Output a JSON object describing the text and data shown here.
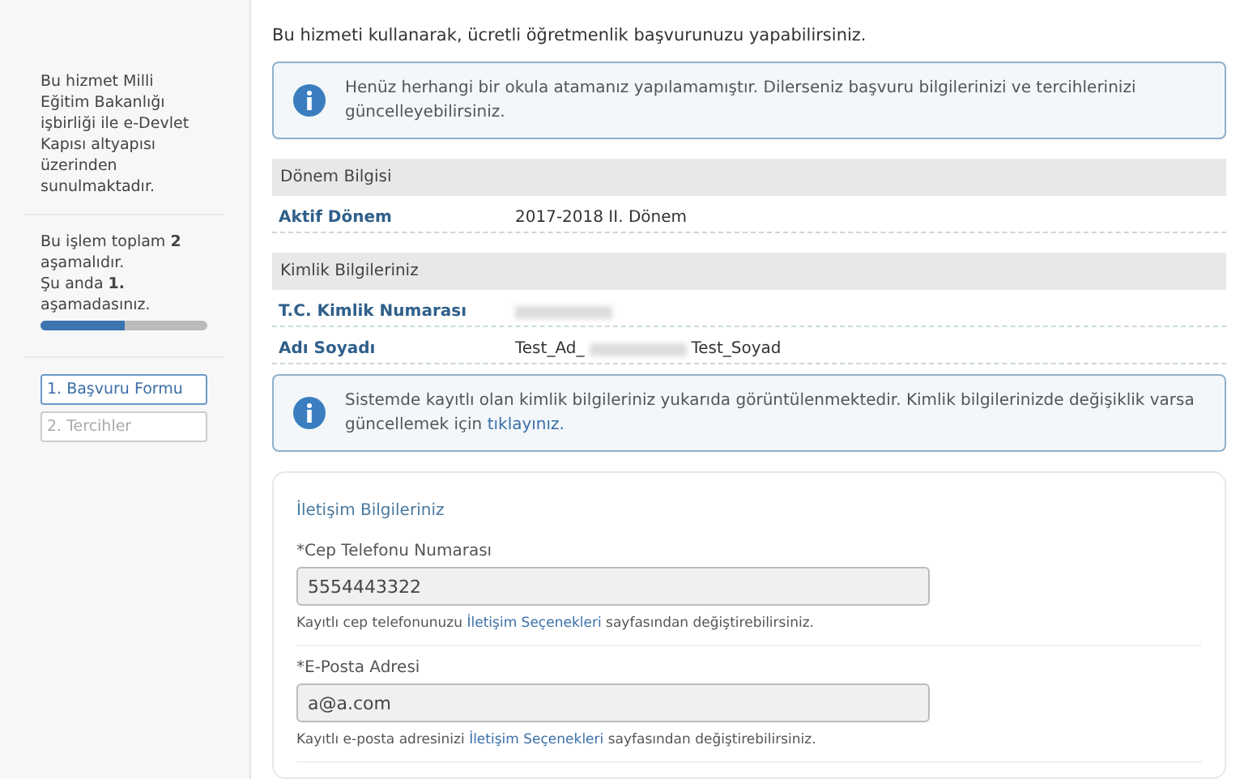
{
  "sidebar": {
    "intro": "Bu hizmet Milli Eğitim Bakanlığı işbirliği ile e-Devlet Kapısı altyapısı üzerinden sunulmaktadır.",
    "progress_text": "Bu işlem toplam **2** aşamalıdır.",
    "progress_current": "Şu anda **1.** aşamadasınız.",
    "progress": {
      "level": 0.5
    },
    "steps": [
      {
        "label": "1. Başvuru Formu",
        "selected": true
      },
      {
        "label": "2. Tercihler",
        "selected": false
      }
    ]
  },
  "intro": "Bu hizmeti kullanarak, ücretli öğretmenlik başvurunuzu yapabilirsiniz.",
  "notice": {
    "text": "Henüz herhangi bir okula atamanız yapılamamıştır. Dilerseniz başvuru bilgilerinizi ve tercihlerinizi güncelleyebilirsiniz."
  },
  "term": {
    "heading": "Dönem Bilgisi",
    "rows": [
      {
        "label": "Aktif Dönem",
        "parts": [
          {
            "kind": "text",
            "text": "2017-2018 II. Dönem"
          }
        ]
      }
    ]
  },
  "identity": {
    "heading": "Kimlik Bilgileriniz",
    "rows": [
      {
        "label": "T.C. Kimlik Numarası",
        "parts": [
          {
            "kind": "redacted"
          }
        ]
      },
      {
        "label": "Adı Soyadı",
        "parts": [
          {
            "kind": "text",
            "text": "Test_Ad_"
          },
          {
            "kind": "redacted"
          },
          {
            "kind": "text",
            "text": "Test_Soyad"
          }
        ]
      }
    ],
    "notice": {
      "text": "Sistemde kayıtlı olan kimlik bilgileriniz yukarıda görüntülenmektedir. Kimlik bilgilerinizde değişiklik varsa güncellemek için",
      "link": "tıklayınız."
    }
  },
  "contact": {
    "heading": "İletişim Bilgileriniz",
    "fields": [
      {
        "label": "*Cep Telefonu Numarası",
        "value": "5554443322",
        "help_before": "Kayıtlı cep telefonunuzu",
        "help_link": "İletişim Seçenekleri",
        "help_after": "sayfasından değiştirebilirsiniz."
      },
      {
        "label": "*E-Posta Adresi",
        "value": "a@a.com",
        "help_before": "Kayıtlı e-posta adresinizi",
        "help_link": "İletişim Seçenekleri",
        "help_after": "sayfasından değiştirebilirsiniz."
      }
    ]
  }
}
